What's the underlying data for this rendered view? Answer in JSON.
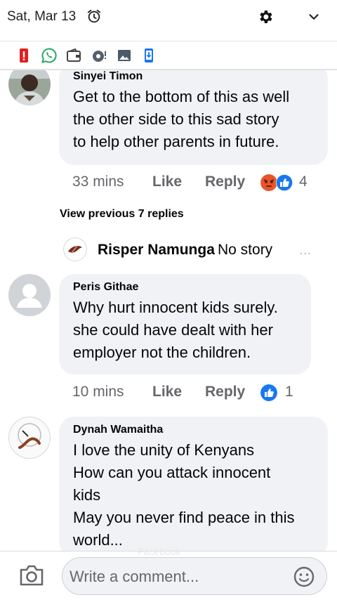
{
  "status_bar": {
    "date": "Sat, Mar 13",
    "icons": [
      "alarm-icon",
      "gear-icon",
      "chevron-down-icon"
    ]
  },
  "notification_icons": [
    "battery-alert-icon",
    "whatsapp-icon",
    "wallet-icon",
    "camera-badge-icon",
    "image-icon",
    "phone-download-icon"
  ],
  "colors": {
    "bubble_bg": "#f0f2f5",
    "secondary_text": "#65676b",
    "like_blue": "#1877f2",
    "angry_orange": "#e8542b",
    "alert_red": "#e02020",
    "whatsapp_green": "#25a760"
  },
  "comments": [
    {
      "author": "Sinyei Timon",
      "text": "Get to the bottom of this as well\nthe other side to this sad story\nto help other parents in future.",
      "time": "33 mins",
      "like_label": "Like",
      "reply_label": "Reply",
      "reactions": [
        "angry",
        "like"
      ],
      "reaction_count": "4"
    },
    {
      "author": "Peris Githae",
      "text": "Why hurt innocent kids surely.\nshe could have dealt with  her\nemployer not the children.",
      "time": "10 mins",
      "like_label": "Like",
      "reply_label": "Reply",
      "reactions": [
        "like"
      ],
      "reaction_count": "1"
    },
    {
      "author": "Dynah Wamaitha",
      "text": "I love the unity of Kenyans\nHow can you attack innocent\nkids\nMay you never find peace in this\nworld..."
    }
  ],
  "view_previous": "View previous 7 replies",
  "reply_preview": {
    "author": "Risper Namunga",
    "text": "No story",
    "ellipsis": "..."
  },
  "composer": {
    "placeholder": "Write a comment...",
    "watermark": "Facebook"
  }
}
